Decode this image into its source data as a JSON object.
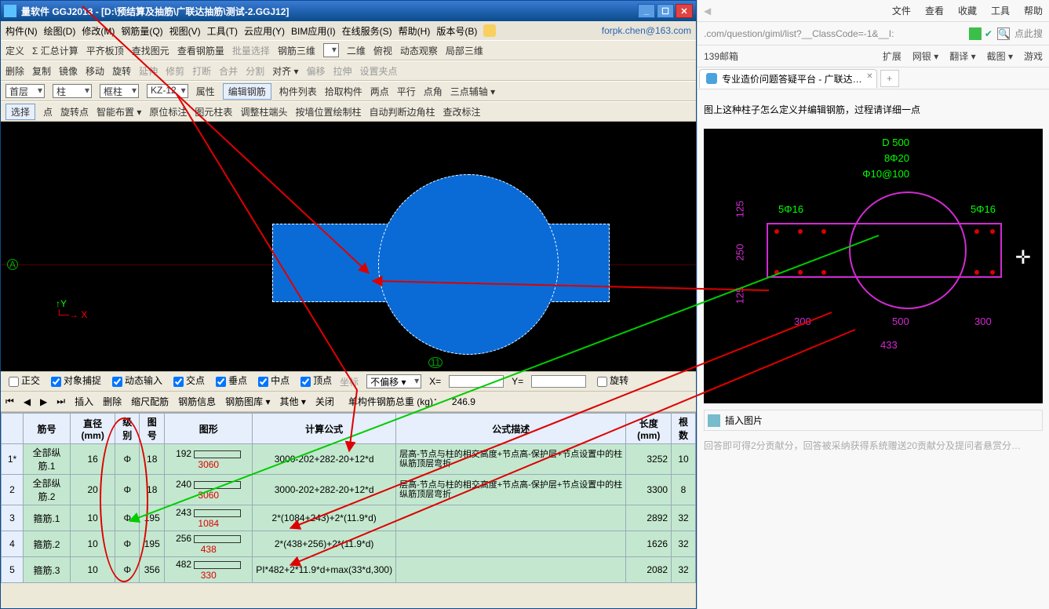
{
  "titlebar": {
    "text": "量软件 GGJ2013 - [D:\\预结算及抽筋\\广联达抽筋\\测试-2.GGJ12]"
  },
  "menu": [
    "构件(N)",
    "绘图(D)",
    "修改(M)",
    "钢筋量(Q)",
    "视图(V)",
    "工具(T)",
    "云应用(Y)",
    "BIM应用(I)",
    "在线服务(S)",
    "帮助(H)",
    "版本号(B)"
  ],
  "menu_email": "forpk.chen@163.com",
  "tb1": [
    {
      "t": "定义"
    },
    {
      "t": "Σ 汇总计算"
    },
    {
      "t": "平齐板顶"
    },
    {
      "t": "查找图元"
    },
    {
      "t": "查看钢筋量"
    },
    {
      "t": "批量选择",
      "dis": true
    },
    {
      "t": "钢筋三维"
    },
    {
      "t": "",
      "drop": ""
    },
    {
      "t": "二维"
    },
    {
      "t": "俯视"
    },
    {
      "t": "动态观察"
    },
    {
      "t": "局部三维"
    }
  ],
  "tb2": [
    {
      "t": "删除"
    },
    {
      "t": "复制"
    },
    {
      "t": "镜像"
    },
    {
      "t": "移动"
    },
    {
      "t": "旋转"
    },
    {
      "t": "延伸",
      "dis": true
    },
    {
      "t": "修剪",
      "dis": true
    },
    {
      "t": "打断",
      "dis": true
    },
    {
      "t": "合并",
      "dis": true
    },
    {
      "t": "分割",
      "dis": true
    },
    {
      "t": "对齐 ▾"
    },
    {
      "t": "偏移",
      "dis": true
    },
    {
      "t": "拉伸",
      "dis": true
    },
    {
      "t": "设置夹点",
      "dis": true
    }
  ],
  "tb3": {
    "d1": "首层",
    "d2": "柱",
    "d3": "框柱",
    "d4": "KZ-12",
    "btns": [
      "属性",
      "编辑钢筋",
      "构件列表",
      "拾取构件",
      "两点",
      "平行",
      "点角",
      "三点辅轴 ▾"
    ]
  },
  "tb4": [
    "选择",
    "点",
    "旋转点",
    "智能布置 ▾",
    "原位标注",
    "图元柱表",
    "调整柱端头",
    "按墙位置绘制柱",
    "自动判断边角柱",
    "查改标注"
  ],
  "viewport": {
    "axisA": "A",
    "axisNum": "11",
    "y": "Y",
    "x": "X"
  },
  "btool": {
    "items": [
      "正交",
      "对象捕捉",
      "动态输入",
      "交点",
      "垂点",
      "中点",
      "顶点",
      "坐标",
      "不偏移 ▾"
    ],
    "x": "X=",
    "y": "Y=",
    "rotate": "旋转",
    "xval": "",
    "yval": ""
  },
  "tabtool": {
    "arrows": true,
    "items": [
      "插入",
      "删除",
      "缩尺配筋",
      "钢筋信息",
      "钢筋图库 ▾",
      "其他 ▾",
      "关闭"
    ],
    "summary_label": "单构件钢筋总重 (kg)：",
    "summary_value": "246.9"
  },
  "columns": [
    "",
    "筋号",
    "直径(mm)",
    "级别",
    "图号",
    "图形",
    "计算公式",
    "公式描述",
    "长度(mm)",
    "根数"
  ],
  "rows": [
    {
      "n": "1*",
      "name": "全部纵筋.1",
      "dia": "16",
      "lvl": "Φ",
      "fig": "18",
      "shape": {
        "a": "192",
        "b": "3060"
      },
      "formula": "3000-202+282-20+12*d",
      "desc": "层高-节点与柱的相交高度+节点高-保护层+节点设置中的柱纵筋顶层弯折",
      "len": "3252",
      "qty": "10"
    },
    {
      "n": "2",
      "name": "全部纵筋.2",
      "dia": "20",
      "lvl": "Φ",
      "fig": "18",
      "shape": {
        "a": "240",
        "b": "3060"
      },
      "formula": "3000-202+282-20+12*d",
      "desc": "层高-节点与柱的相交高度+节点高-保护层+节点设置中的柱纵筋顶层弯折",
      "len": "3300",
      "qty": "8"
    },
    {
      "n": "3",
      "name": "箍筋.1",
      "dia": "10",
      "lvl": "Φ",
      "fig": "195",
      "shape": {
        "a": "243",
        "b": "1084"
      },
      "formula": "2*(1084+243)+2*(11.9*d)",
      "desc": "",
      "len": "2892",
      "qty": "32"
    },
    {
      "n": "4",
      "name": "箍筋.2",
      "dia": "10",
      "lvl": "Φ",
      "fig": "195",
      "shape": {
        "a": "256",
        "b": "438"
      },
      "formula": "2*(438+256)+2*(11.9*d)",
      "desc": "",
      "len": "1626",
      "qty": "32"
    },
    {
      "n": "5",
      "name": "箍筋.3",
      "dia": "10",
      "lvl": "Φ",
      "fig": "356",
      "shape": {
        "a": "482",
        "b": "330"
      },
      "formula": "PI*482+2*11.9*d+max(33*d,300)",
      "desc": "",
      "len": "2082",
      "qty": "32"
    }
  ],
  "browser": {
    "menu": [
      "文件",
      "查看",
      "收藏",
      "工具",
      "帮助"
    ],
    "url": ".com/question/giml/list?__ClassCode=-1&__I:",
    "ext": [
      "139邮箱",
      "扩展",
      "网银 ▾",
      "翻译 ▾",
      "截图 ▾",
      "游戏"
    ],
    "tab": "专业造价问题答疑平台 - 广联达…",
    "question": "图上这种柱子怎么定义并编辑钢筋，过程请详细一点",
    "diagram": {
      "D": "D 500",
      "bars1": "8Φ20",
      "bars2": "Φ10@100",
      "left": "5Φ16",
      "right": "5Φ16",
      "h125a": "125",
      "h250": "250",
      "h125b": "125",
      "w300a": "300",
      "w500": "500",
      "w300b": "300",
      "w433": "433"
    },
    "insert": "插入图片",
    "tip": "回答即可得2分贡献分，回答被采纳获得系统赠送20贡献分及提问者悬赏分…"
  }
}
